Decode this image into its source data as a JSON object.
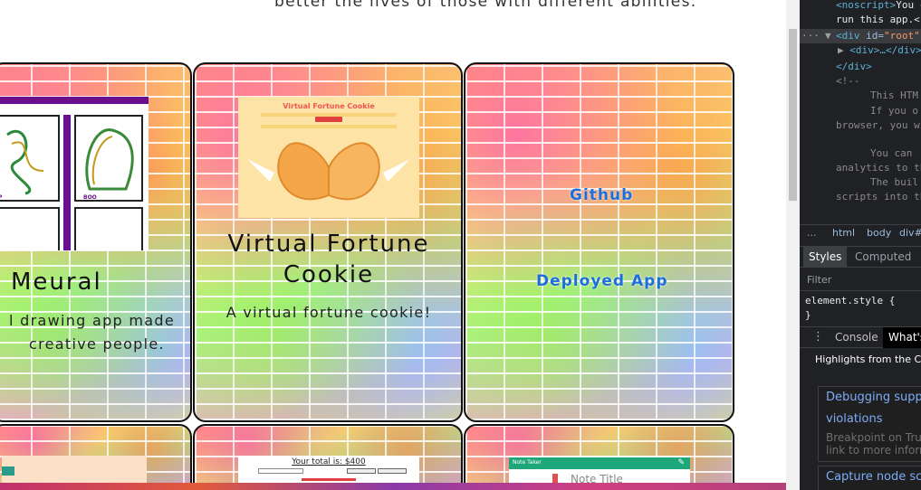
{
  "page": {
    "intro_text": "better the lives of those with different abilities."
  },
  "cards": [
    {
      "title": "Meural",
      "description_lines": [
        "l drawing app made",
        "creative people."
      ]
    },
    {
      "title_lines": [
        "Virtual Fortune",
        "Cookie"
      ],
      "description": "A virtual fortune cookie!",
      "thumb_title": "Virtual Fortune Cookie"
    },
    {
      "links": [
        "Github",
        "Deployed App"
      ]
    }
  ],
  "bottom_cards": {
    "card5_heading": "Your total is: $400",
    "card6_header": "Note Taker",
    "card6_note": "Note Title"
  },
  "meural_thumb": {
    "captions": [
      "BOO",
      "P"
    ]
  },
  "devtools": {
    "dom_lines": [
      {
        "tag_open": "<noscript>",
        "text": "You c"
      },
      {
        "text": "run this app.<"
      },
      {
        "tag_open": "<div ",
        "attr": "id=",
        "str": "\"root\""
      },
      {
        "text": "<div>…</div>"
      },
      {
        "text": "</div>"
      },
      {
        "text": "<!--"
      },
      {
        "text": "This HTM"
      },
      {
        "text": "If you o"
      },
      {
        "text": "browser, you wi"
      },
      {
        "text": "You can"
      },
      {
        "text": "analytics to th"
      },
      {
        "text": "The buil"
      },
      {
        "text": "scripts into th"
      }
    ],
    "breadcrumbs": [
      "...",
      "html",
      "body",
      "div#"
    ],
    "style_tabs": [
      "Styles",
      "Computed"
    ],
    "filter_placeholder": "Filter",
    "element_style_open": "element.style {",
    "element_style_close": "}",
    "drawer_tabs": [
      "Console",
      "What's"
    ],
    "whats_new_title": "Highlights from the Ch",
    "news": [
      {
        "link_lines": [
          "Debugging suppo",
          "violations"
        ],
        "desc_lines": [
          "Breakpoint on Trus",
          "link to more inform"
        ]
      },
      {
        "link_lines": [
          "Capture node scr"
        ],
        "desc_lines": []
      }
    ]
  },
  "colors": {
    "link": "#1e6fd9",
    "devtools_bg": "#202124",
    "devtools_tag": "#5db0d7"
  }
}
